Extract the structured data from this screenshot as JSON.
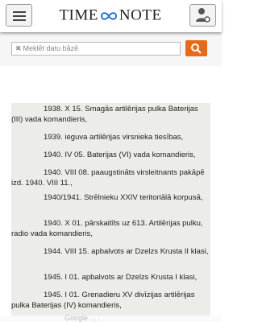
{
  "header": {
    "logo_left": "TIME",
    "logo_right": "NOTE",
    "menu_icon": "hamburger-icon",
    "user_icon": "user-settings-icon"
  },
  "search": {
    "placeholder": "Meklēt datu bāzē",
    "button_icon": "search-icon"
  },
  "entries": [
    "1938. X 15. Smagās artilērijas pulka Baterijas (III) vada komandieris,",
    "1939. ieguva artilērijas virsnieka tiesības,",
    "1940. IV 05. Baterijas (VI) vada komandieris,",
    "1940. VIII 08. paaugstināts virsleitnants pakāpē izd. 1940. VIII 11.,",
    "1940/1941. Strēlnieku XXIV teritoriālā korpusā,",
    "1940. X 01. pārskaitīts uz 613. Artilērijas pulku, radio vada komandieris,",
    "1944. VIII 15. apbalvots ar Dzelzs Krusta II klasi,",
    "1945. I 01. apbalvots ar Dzelzs Krusta I klasi,",
    "1945. I 01. Grenadieru XV divīzijas artilērijas pulka Baterijas (IV) komandieris,"
  ],
  "bottom": {
    "text": "Google ... ."
  },
  "colors": {
    "accent": "#e66a1a",
    "content_bg": "#ecede8"
  }
}
